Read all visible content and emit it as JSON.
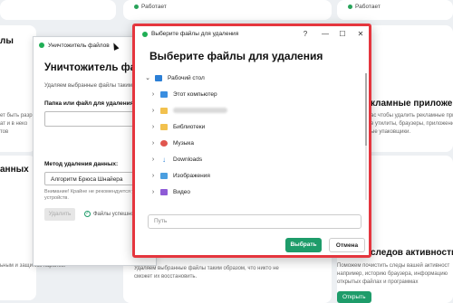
{
  "background": {
    "status_label": "Работает",
    "heading_left_top": "лы",
    "heading_left_mid": "анных",
    "text_left_1": "ет быть разр",
    "text_left_2": "ат и в неко",
    "text_left_3": "тов",
    "text_left_bottom": "ьным и защитим паролем",
    "heading_right": "кламные приложения",
    "text_right_1": "ас чтобы удалить рекламные прилох",
    "text_right_2": "е утилиты, браузеры, приложения автодо",
    "text_right_3": "ые упаковщики.",
    "heading_right_bottom": "следов активности",
    "text_right_b1": "Поможем почистить следы вашей активност",
    "text_right_b2": "например, историю браузера, информацию",
    "text_right_b3": "открытых файлах и программах",
    "text_mid_b1": "Удаляем выбранные файлы таким образом, что никто не",
    "text_mid_b2": "сможет их восстановить.",
    "green_btn_bg": "Открыть"
  },
  "shredder": {
    "window_title": "Уничтожитель файлов",
    "heading": "Уничтожитель файл",
    "description": "Удаляем выбранные файлы таким о",
    "folder_label": "Папка или файл для удаления:",
    "method_label": "Метод удаления данных:",
    "method_value": "Алгоритм Брюса Шнайера",
    "warning_1": "Внимание! Крайне не рекомендуется уда",
    "warning_2": "устройств.",
    "delete_button": "Удалить",
    "success_text": "Файлы успешно уд"
  },
  "dialog": {
    "window_title": "Выберите файлы для удаления",
    "help_glyph": "?",
    "minimize_glyph": "—",
    "maximize_glyph": "☐",
    "close_glyph": "✕",
    "heading": "Выберите файлы для удаления",
    "tree": [
      {
        "label": "Рабочий стол",
        "icon": "desktop-icon",
        "expanded": true
      },
      {
        "label": "Этот компьютер",
        "icon": "computer-icon"
      },
      {
        "label": "",
        "icon": "folder-icon",
        "blurred": true
      },
      {
        "label": "Библиотеки",
        "icon": "folder-icon"
      },
      {
        "label": "Музыка",
        "icon": "music-icon"
      },
      {
        "label": "Downloads",
        "icon": "download-icon"
      },
      {
        "label": "Изображения",
        "icon": "image-icon"
      },
      {
        "label": "Видео",
        "icon": "video-icon"
      }
    ],
    "path_placeholder": "Путь",
    "select_button": "Выбрать",
    "cancel_button": "Отмена"
  },
  "colors": {
    "accent": "#1e9c6a",
    "highlight_border": "#e5363e",
    "status_green": "#28a35a"
  }
}
